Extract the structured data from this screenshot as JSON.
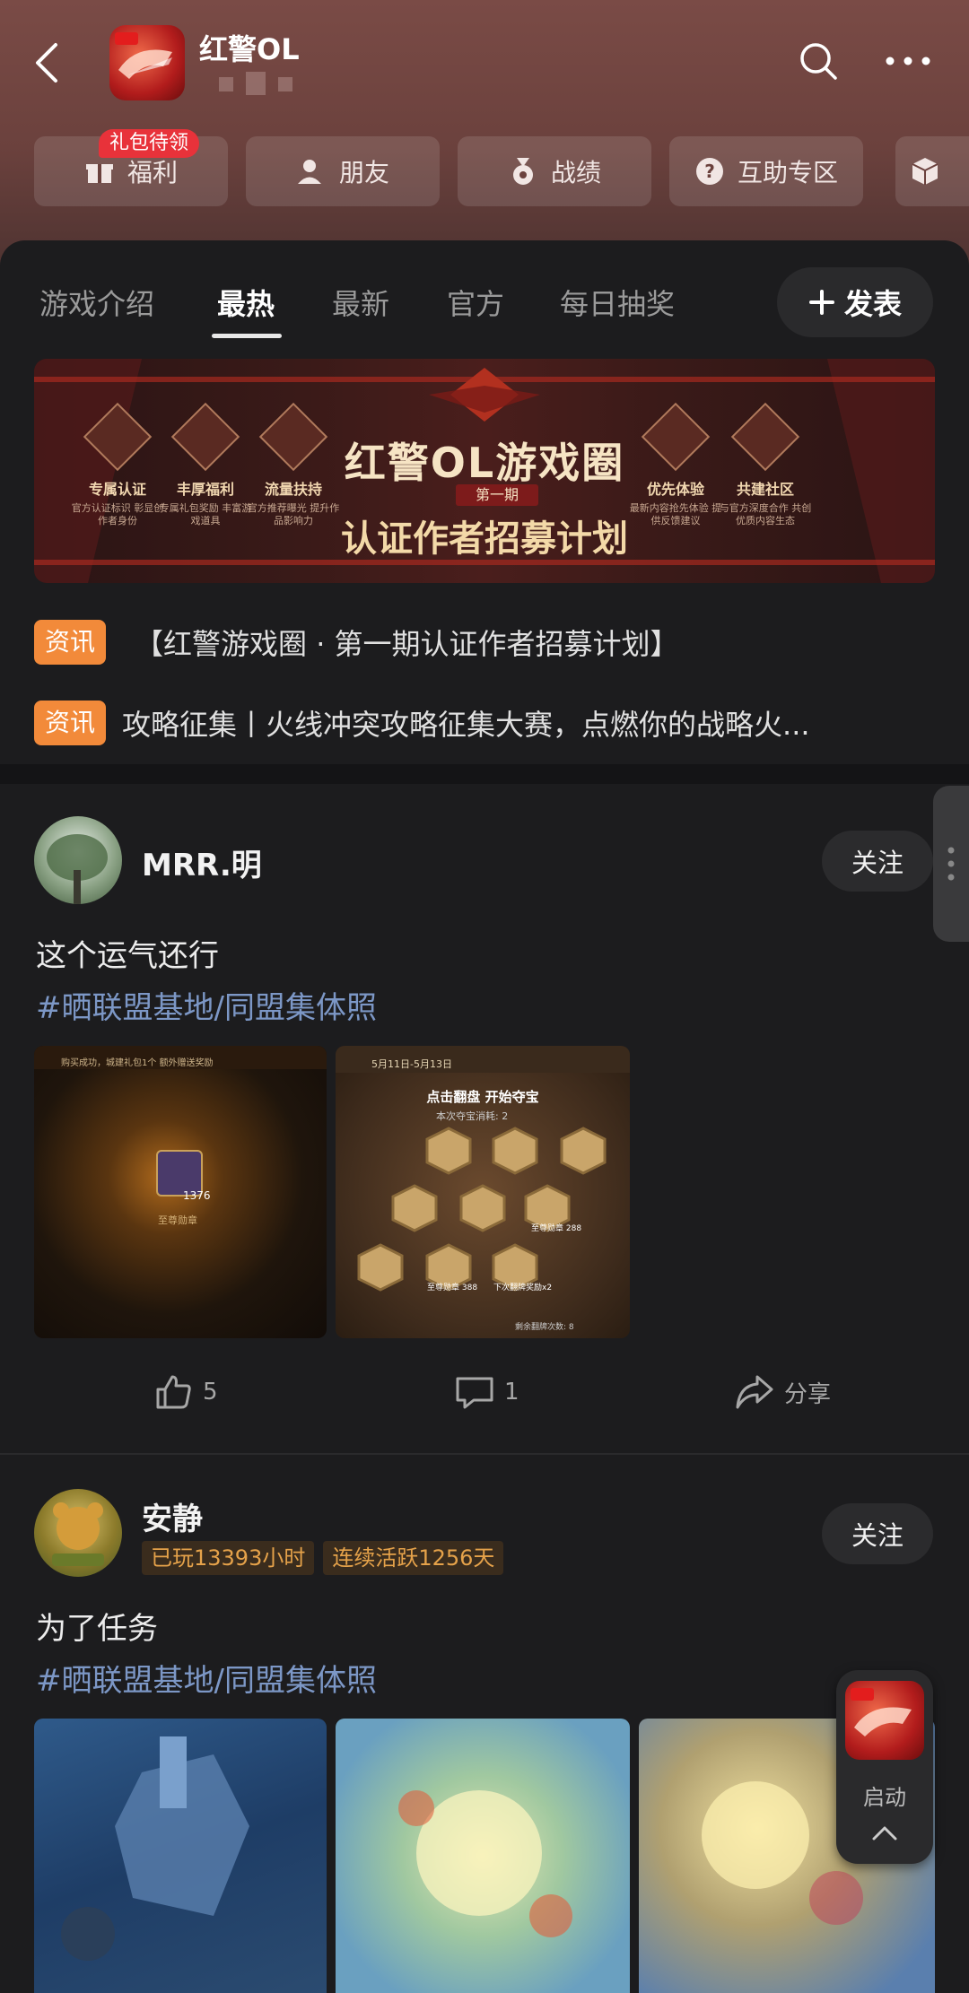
{
  "header": {
    "title": "红警OL"
  },
  "quick_links": [
    {
      "label": "福利",
      "icon": "gift-icon",
      "badge": "礼包待领"
    },
    {
      "label": "朋友",
      "icon": "friend-icon"
    },
    {
      "label": "战绩",
      "icon": "medal-icon"
    },
    {
      "label": "互助专区",
      "icon": "question-icon"
    },
    {
      "label": "",
      "icon": "cube-icon"
    }
  ],
  "tabs": {
    "items": [
      "游戏介绍",
      "最热",
      "最新",
      "官方",
      "每日抽奖"
    ],
    "active": "最热",
    "post_button": "发表"
  },
  "banner": {
    "title": "红警OL游戏圈",
    "issue": "第一期",
    "subtitle": "认证作者招募计划",
    "features": [
      {
        "label": "专属认证",
        "desc": "官方认证标识 彰显创作者身份"
      },
      {
        "label": "丰厚福利",
        "desc": "专属礼包奖励 丰富游戏道具"
      },
      {
        "label": "流量扶持",
        "desc": "官方推荐曝光 提升作品影响力"
      },
      {
        "label": "优先体验",
        "desc": "最新内容抢先体验 提供反馈建议"
      },
      {
        "label": "共建社区",
        "desc": "与官方深度合作 共创优质内容生态"
      }
    ]
  },
  "news": [
    {
      "tag": "资讯",
      "text": "【红警游戏圈 · 第一期认证作者招募计划】"
    },
    {
      "tag": "资讯",
      "text": "攻略征集丨火线冲突攻略征集大赛，点燃你的战略火..."
    }
  ],
  "posts": [
    {
      "username": "MRR.明",
      "follow": "关注",
      "text": "这个运气还行",
      "hashtag": "#晒联盟基地/同盟集体照",
      "likes": "5",
      "comments": "1",
      "share": "分享",
      "img1": {
        "caption_top": "购买成功，城建礼包1个 额外赠送奖励",
        "item_count": "1376",
        "item_name": "至尊勋章"
      },
      "img2": {
        "date": "5月11日-5月13日",
        "title": "点击翻盘 开始夺宝",
        "cost_label": "本次夺宝消耗:",
        "cost": "2",
        "prize1": "至尊勋章",
        "prize1_count": "288",
        "prize2": "至尊勋章",
        "prize2_count": "388",
        "prize3": "下次翻牌奖励x2",
        "remaining": "剩余翻牌次数: 8"
      }
    },
    {
      "username": "安静",
      "follow": "关注",
      "stats": [
        "已玩13393小时",
        "连续活跃1256天"
      ],
      "text": "为了任务",
      "hashtag": "#晒联盟基地/同盟集体照"
    }
  ],
  "floating": {
    "label": "启动"
  },
  "colors": {
    "accent_orange": "#f28a3a",
    "hashtag_blue": "#7c97c6",
    "badge_red": "#e8323a",
    "header_bg": "#7a4b46"
  }
}
